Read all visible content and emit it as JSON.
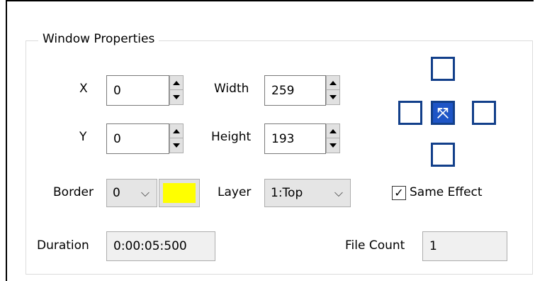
{
  "group": {
    "title": "Window Properties"
  },
  "fields": {
    "x": {
      "label": "X",
      "value": "0"
    },
    "y": {
      "label": "Y",
      "value": "0"
    },
    "width": {
      "label": "Width",
      "value": "259"
    },
    "height": {
      "label": "Height",
      "value": "193"
    },
    "border": {
      "label": "Border",
      "value": "0"
    },
    "layer": {
      "label": "Layer",
      "value": "1:Top"
    },
    "duration": {
      "label": "Duration",
      "value": "0:00:05:500"
    },
    "file_count": {
      "label": "File Count",
      "value": "1"
    }
  },
  "border_color": "#ffff00",
  "same_effect": {
    "label": "Same Effect",
    "checked": true
  },
  "directions": {
    "top": "move-top-icon",
    "left": "move-left-icon",
    "center": "expand-center-icon",
    "right": "move-right-icon",
    "bottom": "move-bottom-icon"
  }
}
